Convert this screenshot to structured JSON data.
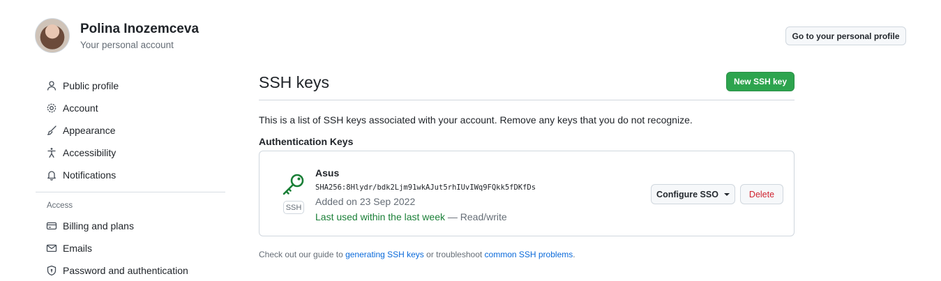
{
  "user": {
    "name": "Polina Inozemceva",
    "subtitle": "Your personal account",
    "profile_button": "Go to your personal profile"
  },
  "sidebar": {
    "items": [
      {
        "label": "Public profile",
        "icon": "person-icon"
      },
      {
        "label": "Account",
        "icon": "gear-icon"
      },
      {
        "label": "Appearance",
        "icon": "paintbrush-icon"
      },
      {
        "label": "Accessibility",
        "icon": "accessibility-icon"
      },
      {
        "label": "Notifications",
        "icon": "bell-icon"
      }
    ],
    "access_heading": "Access",
    "access_items": [
      {
        "label": "Billing and plans",
        "icon": "credit-card-icon"
      },
      {
        "label": "Emails",
        "icon": "mail-icon"
      },
      {
        "label": "Password and authentication",
        "icon": "shield-lock-icon"
      }
    ]
  },
  "main": {
    "title": "SSH keys",
    "new_key_button": "New SSH key",
    "intro": "This is a list of SSH keys associated with your account. Remove any keys that you do not recognize.",
    "auth_heading": "Authentication Keys",
    "keys": [
      {
        "name": "Asus",
        "fingerprint": "SHA256:8Hlydr/bdk2Ljm91wkAJut5rhIUvIWq9FQkk5fDKfDs",
        "type_label": "SSH",
        "added": "Added on 23 Sep 2022",
        "last_used": "Last used within the last week",
        "access": " — Read/write",
        "configure_button": "Configure SSO",
        "delete_button": "Delete"
      }
    ],
    "guide": {
      "prefix": "Check out our guide to ",
      "link1": "generating SSH keys",
      "middle": " or troubleshoot ",
      "link2": "common SSH problems",
      "suffix": "."
    }
  },
  "colors": {
    "primary_button": "#2da44e",
    "success_text": "#1a7f37",
    "danger_text": "#cf222e",
    "link": "#0969da"
  }
}
